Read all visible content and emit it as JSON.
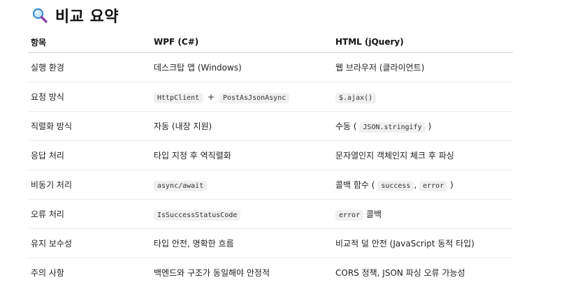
{
  "title": "비교 요약",
  "icon": "magnifying-glass-icon",
  "header": {
    "item": "항목",
    "wpf": "WPF (C#)",
    "html": "HTML (jQuery)"
  },
  "rows": [
    {
      "item": "실행 환경",
      "wpf": "데스크탑 앱 (Windows)",
      "html": "웹 브라우저 (클라이언트)"
    },
    {
      "item": "요청 방식",
      "wpf_code1": "HttpClient",
      "wpf_plus": "+",
      "wpf_code2": "PostAsJsonAsync",
      "html_code": "$.ajax()"
    },
    {
      "item": "직렬화 방식",
      "wpf": "자동 (내장 지원)",
      "html_pre": "수동 (",
      "html_code": "JSON.stringify",
      "html_post": ")"
    },
    {
      "item": "응답 처리",
      "wpf": "타입 지정 후 역직렬화",
      "html": "문자열인지 객체인지 체크 후 파싱"
    },
    {
      "item": "비동기 처리",
      "wpf_code": "async/await",
      "html_pre": "콜백 함수 (",
      "html_code1": "success",
      "html_comma": ",",
      "html_code2": "error",
      "html_post": ")"
    },
    {
      "item": "오류 처리",
      "wpf_code": "IsSuccessStatusCode",
      "html_code": "error",
      "html_post": "콜백"
    },
    {
      "item": "유지 보수성",
      "wpf": "타입 안전, 명확한 흐름",
      "html": "비교적 덜 안전 (JavaScript 동적 타입)"
    },
    {
      "item": "주의 사항",
      "wpf": "백엔드와 구조가 동일해야 안정적",
      "html": "CORS 정책, JSON 파싱 오류 가능성"
    }
  ]
}
